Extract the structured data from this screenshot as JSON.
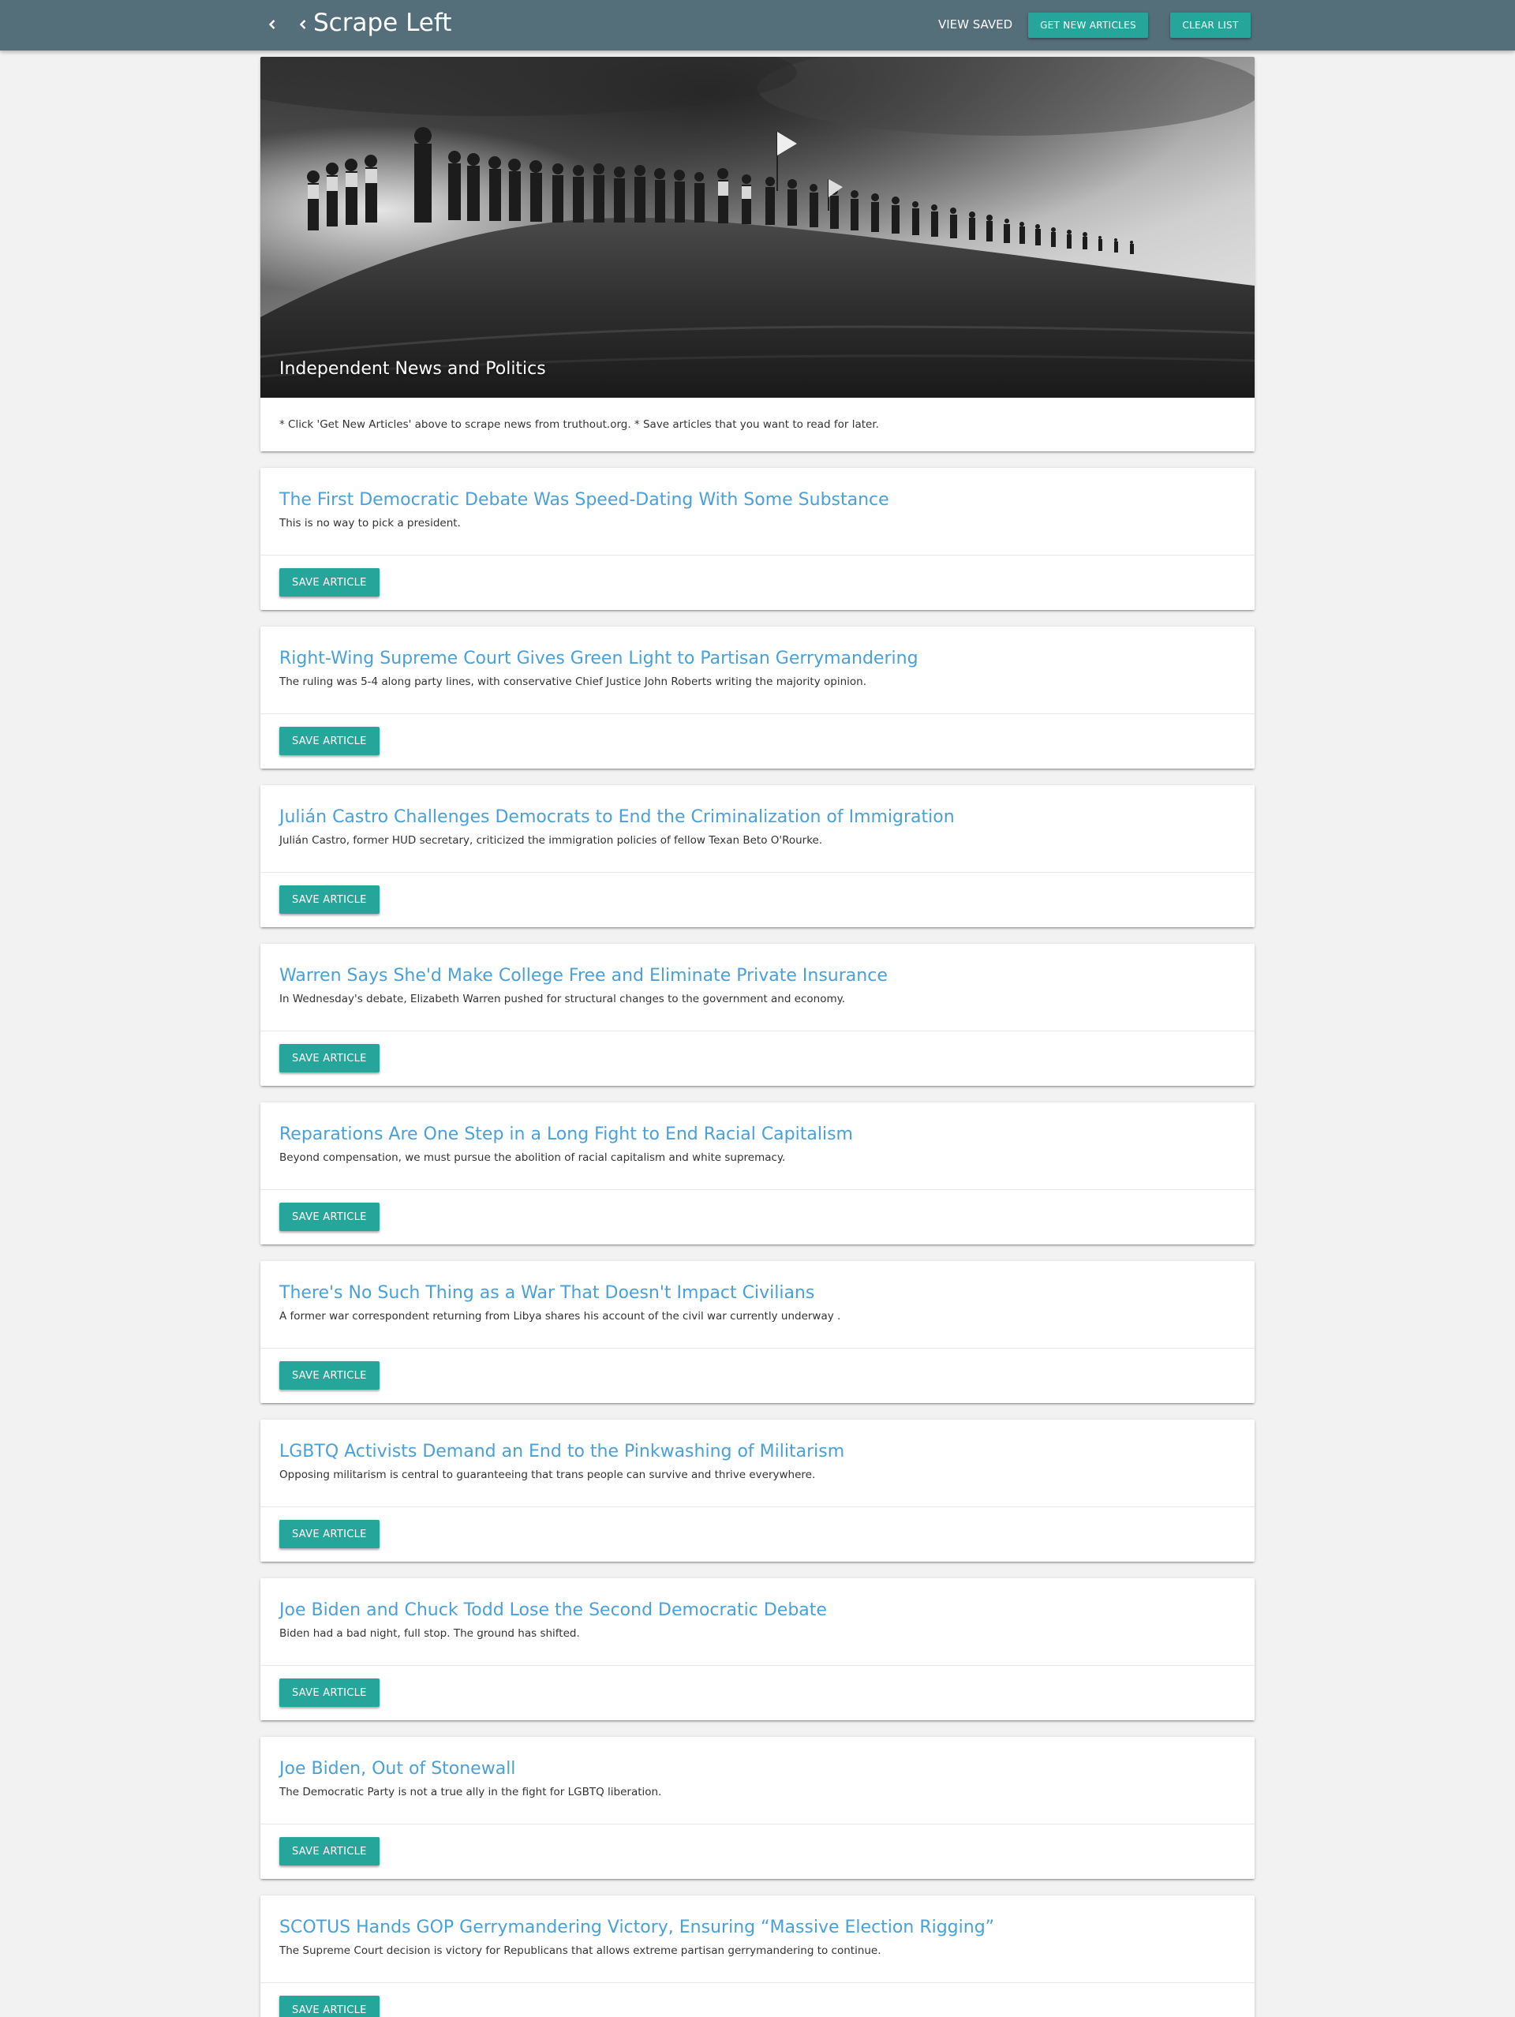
{
  "navbar": {
    "brand": "Scrape Left",
    "view_saved": "View Saved",
    "get_new_articles": "Get New Articles",
    "clear_list": "Clear List",
    "background_color": "#546e7a",
    "button_color": "#26a69a"
  },
  "hero": {
    "title": "Independent News and Politics",
    "instructions": "* Click 'Get New Articles' above to scrape news from truthout.org. * Save articles that you want to read for later."
  },
  "articles": [
    {
      "title": "The First Democratic Debate Was Speed-Dating With Some Substance",
      "summary": "This is no way to pick a president.",
      "button": "Save Article"
    },
    {
      "title": "Right-Wing Supreme Court Gives Green Light to Partisan Gerrymandering",
      "summary": "The ruling was 5-4 along party lines, with conservative Chief Justice John Roberts writing the majority opinion.",
      "button": "Save Article"
    },
    {
      "title": "Julián Castro Challenges Democrats to End the Criminalization of Immigration",
      "summary": "Julián Castro, former HUD secretary, criticized the immigration policies of fellow Texan Beto O'Rourke.",
      "button": "Save Article"
    },
    {
      "title": "Warren Says She'd Make College Free and Eliminate Private Insurance",
      "summary": "In Wednesday's debate, Elizabeth Warren pushed for structural changes to the government and economy.",
      "button": "Save Article"
    },
    {
      "title": "Reparations Are One Step in a Long Fight to End Racial Capitalism",
      "summary": "Beyond compensation, we must pursue the abolition of racial capitalism and white supremacy.",
      "button": "Save Article"
    },
    {
      "title": "There's No Such Thing as a War That Doesn't Impact Civilians",
      "summary": "A former war correspondent returning from Libya shares his account of the civil war currently underway .",
      "button": "Save Article"
    },
    {
      "title": "LGBTQ Activists Demand an End to the Pinkwashing of Militarism",
      "summary": "Opposing militarism is central to guaranteeing that trans people can survive and thrive everywhere.",
      "button": "Save Article"
    },
    {
      "title": "Joe Biden and Chuck Todd Lose the Second Democratic Debate",
      "summary": "Biden had a bad night, full stop. The ground has shifted.",
      "button": "Save Article"
    },
    {
      "title": "Joe Biden, Out of Stonewall",
      "summary": "The Democratic Party is not a true ally in the fight for LGBTQ liberation.",
      "button": "Save Article"
    },
    {
      "title": "SCOTUS Hands GOP Gerrymandering Victory, Ensuring “Massive Election Rigging”",
      "summary": "The Supreme Court decision is victory for Republicans that allows extreme partisan gerrymandering to continue.",
      "button": "Save Article"
    }
  ]
}
